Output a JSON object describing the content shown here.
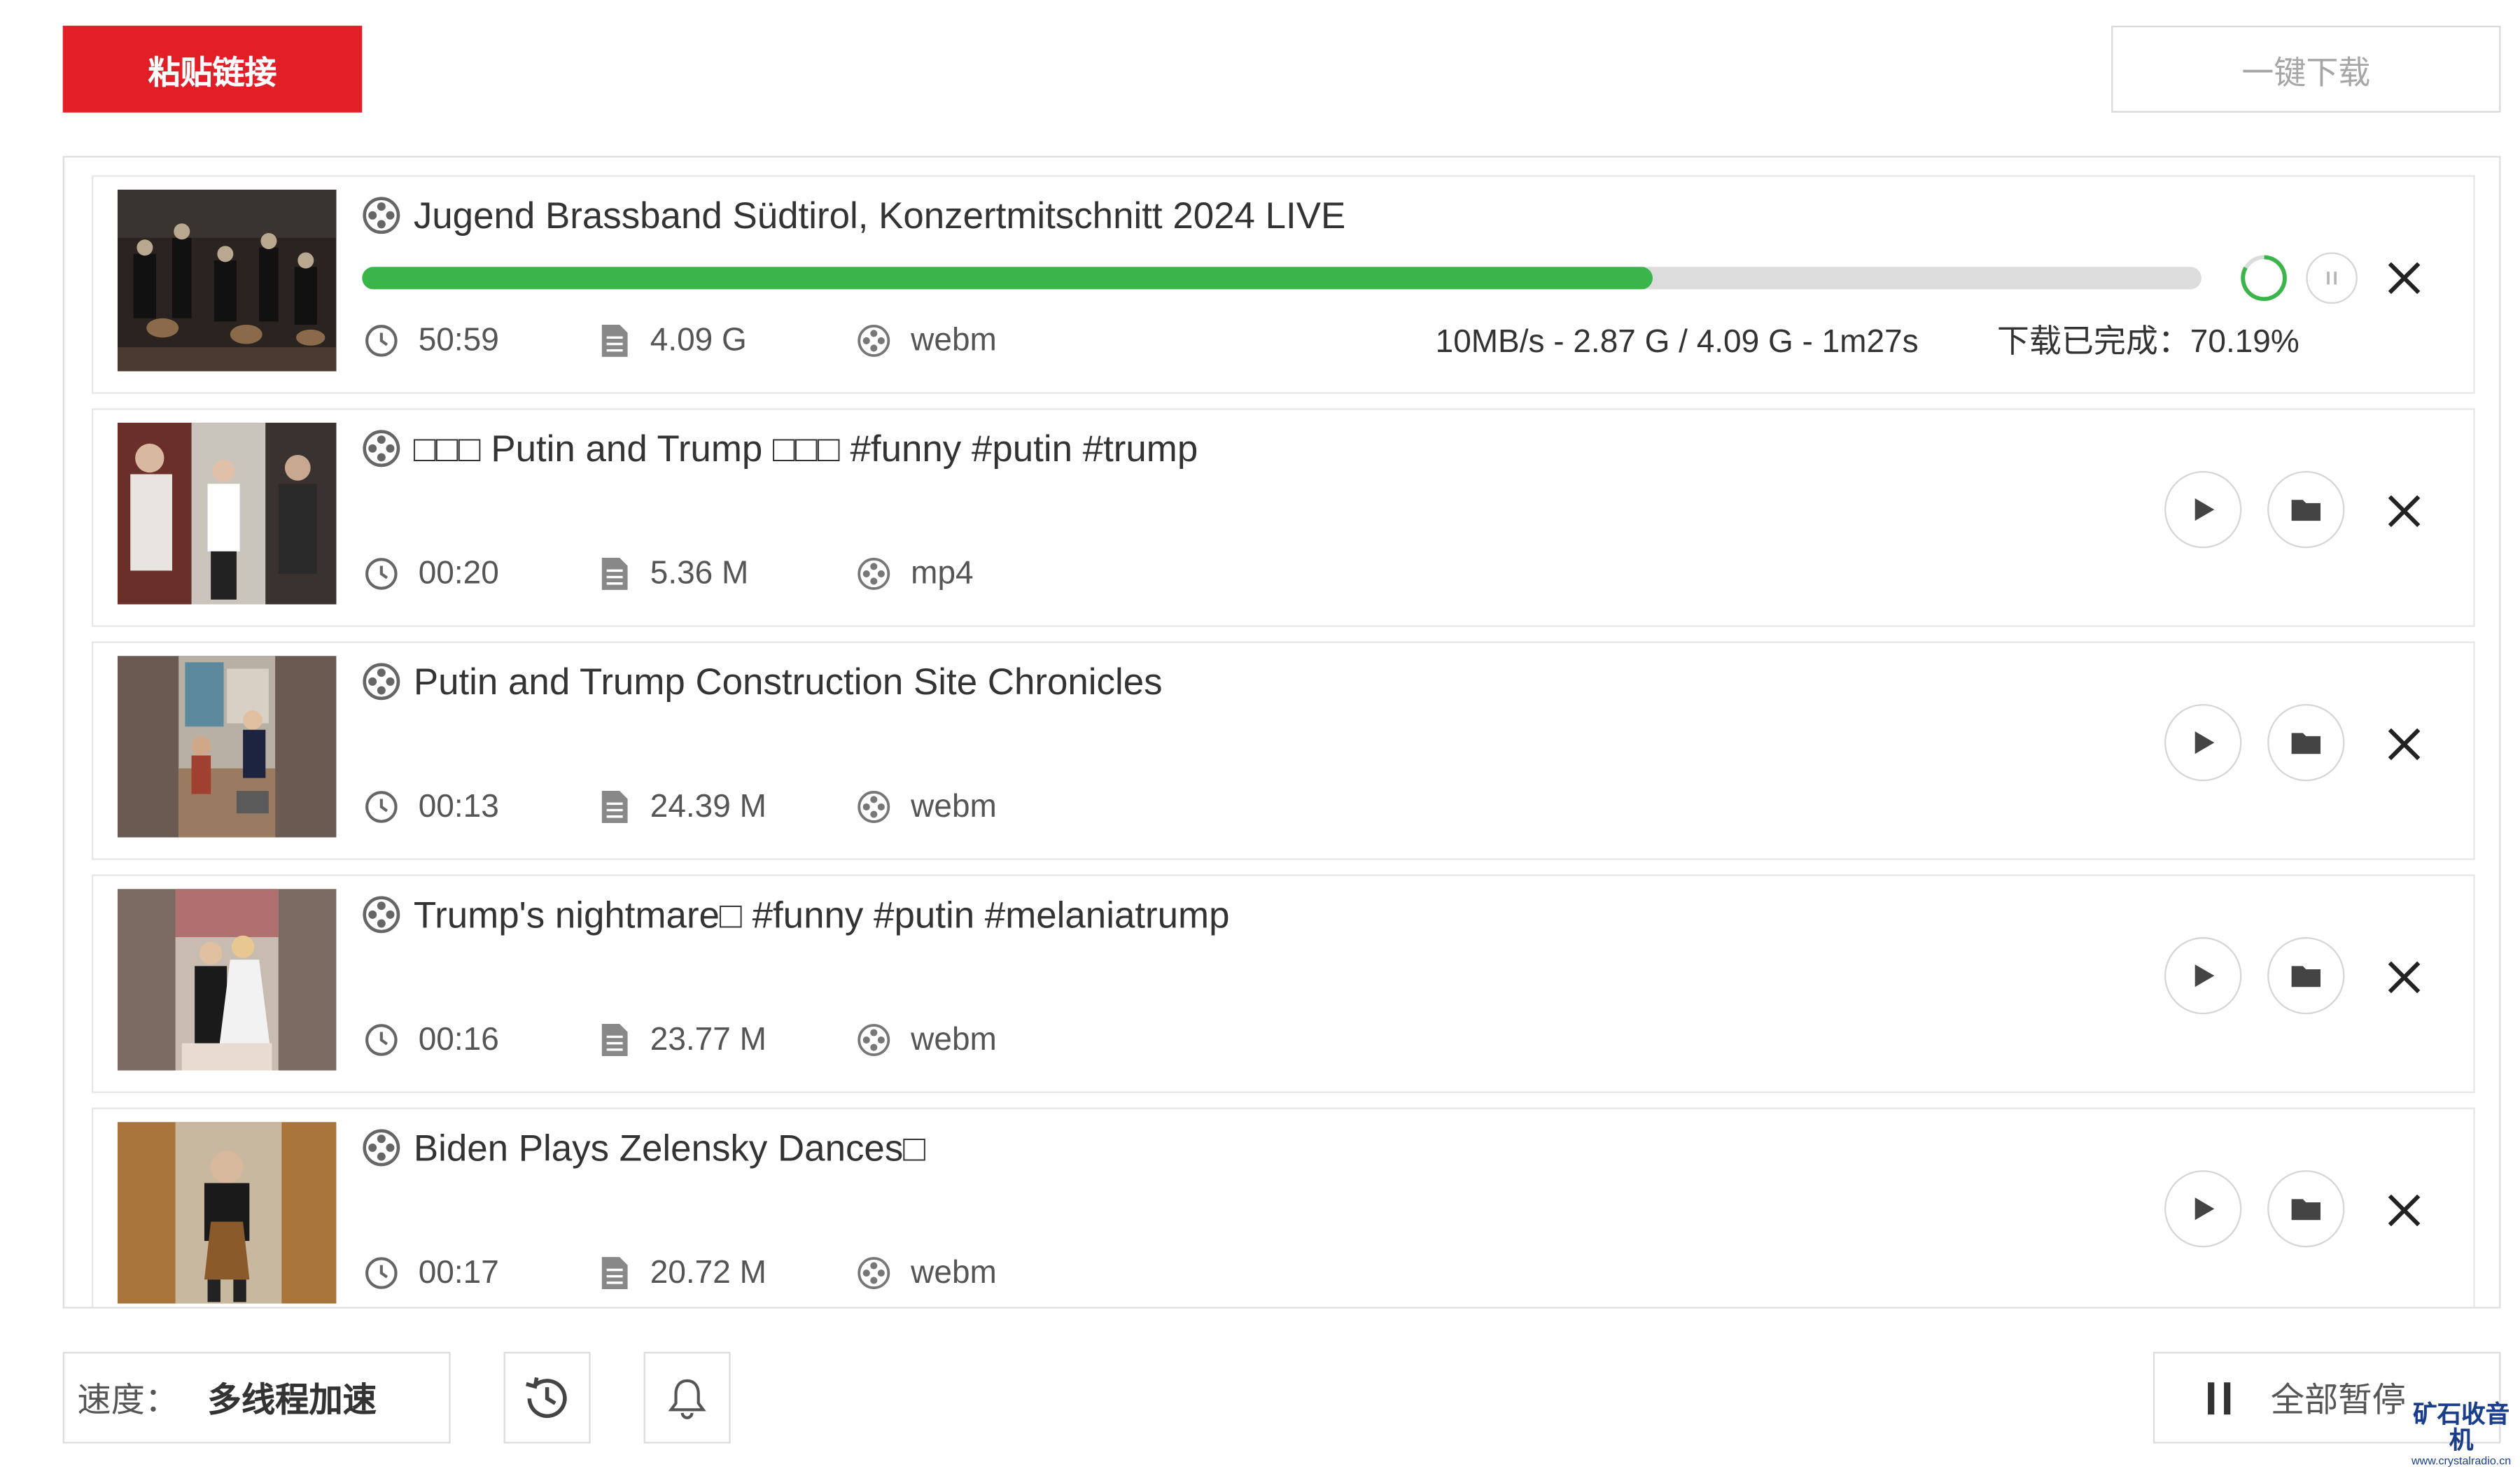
{
  "toolbar": {
    "paste_label": "粘贴链接",
    "download_all_label": "一键下载"
  },
  "items": [
    {
      "title": "Jugend Brassband Südtirol, Konzertmitschnitt 2024 LIVE",
      "duration": "50:59",
      "size": "4.09 G",
      "format": "webm",
      "downloading": true,
      "progress": 0.7019,
      "speed_text": "10MB/s - 2.87 G / 4.09 G - 1m27s",
      "done_text": "下载已完成：70.19%"
    },
    {
      "title": "□□□ Putin and Trump □□□ #funny #putin #trump",
      "duration": "00:20",
      "size": "5.36 M",
      "format": "mp4",
      "downloading": false
    },
    {
      "title": "Putin and Trump Construction Site Chronicles",
      "duration": "00:13",
      "size": "24.39 M",
      "format": "webm",
      "downloading": false
    },
    {
      "title": "Trump's nightmare□ #funny #putin #melaniatrump",
      "duration": "00:16",
      "size": "23.77 M",
      "format": "webm",
      "downloading": false
    },
    {
      "title": "Biden Plays Zelensky Dances□",
      "duration": "00:17",
      "size": "20.72 M",
      "format": "webm",
      "downloading": false
    }
  ],
  "footer": {
    "speed_label": "速度：",
    "speed_value": "多线程加速",
    "pause_all_label": "全部暂停"
  },
  "watermark": {
    "main": "矿石收音机",
    "sub": "www.crystalradio.cn"
  },
  "colors": {
    "accent": "#e21e26",
    "progress": "#3ab54a",
    "border": "#dedede"
  }
}
